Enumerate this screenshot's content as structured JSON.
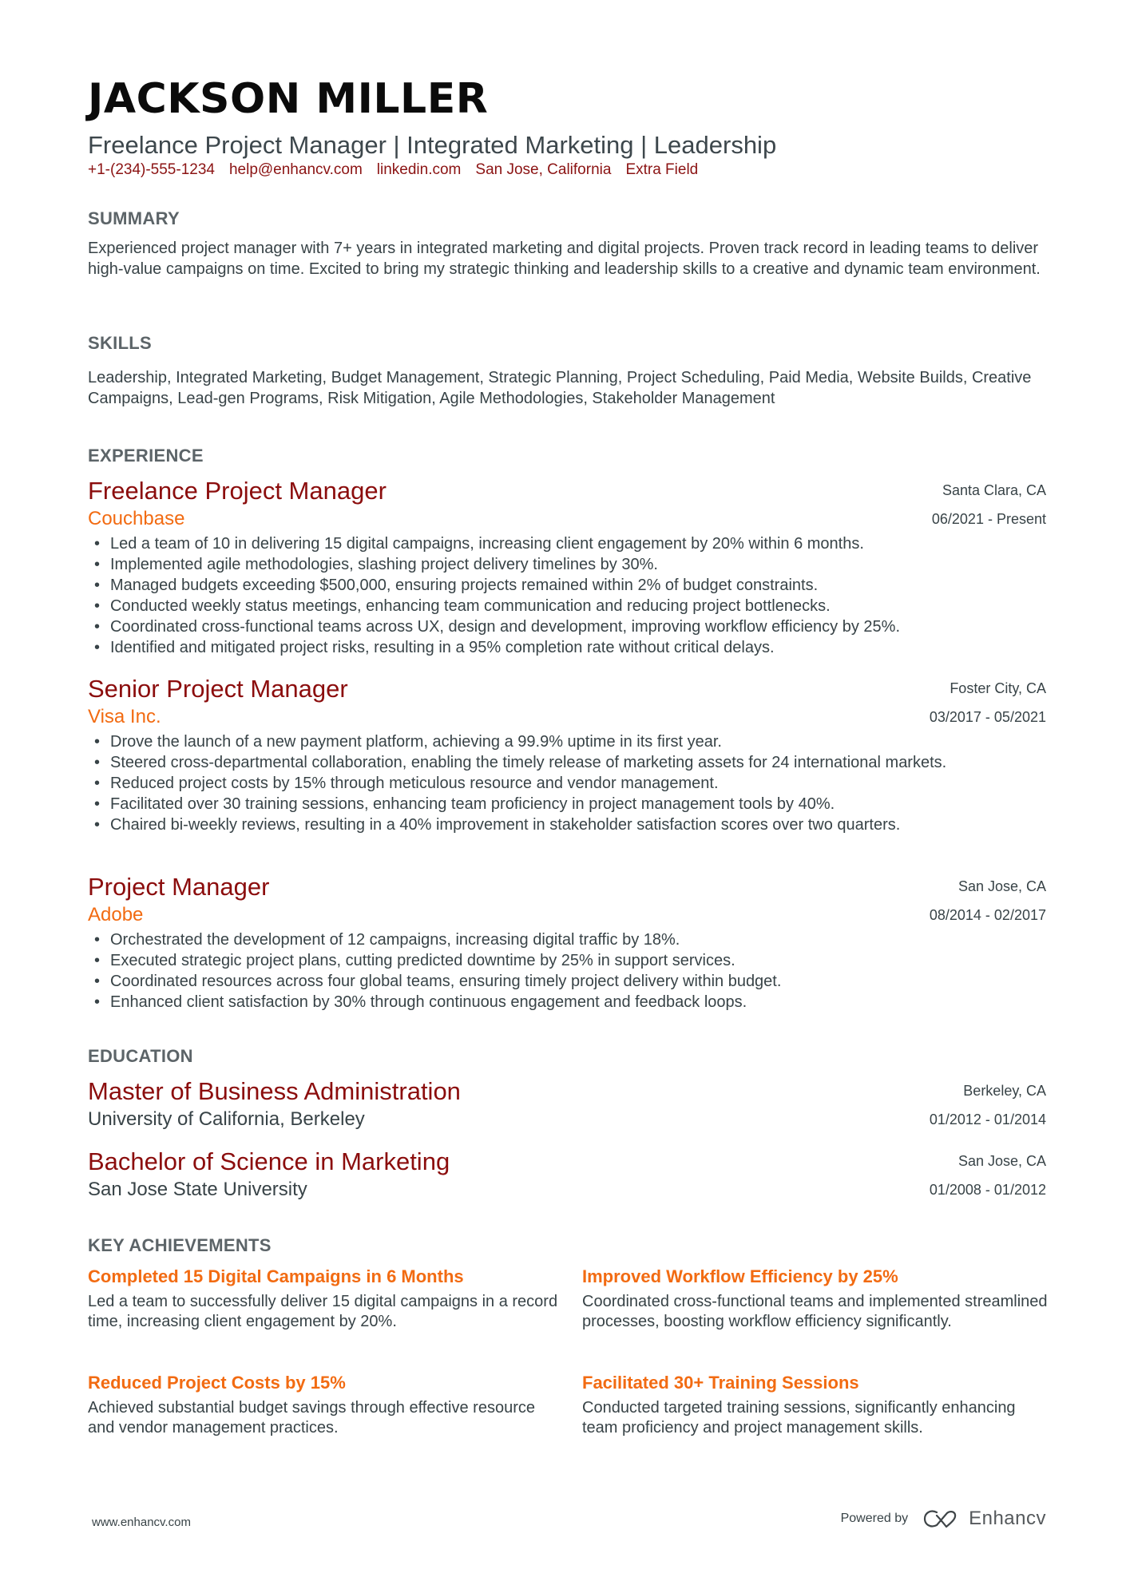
{
  "header": {
    "name": "JACKSON MILLER",
    "subtitle": "Freelance Project Manager | Integrated Marketing | Leadership",
    "contacts": [
      "+1-(234)-555-1234",
      "help@enhancv.com",
      "linkedin.com",
      "San Jose, California",
      "Extra Field"
    ]
  },
  "summary": {
    "heading": "SUMMARY",
    "text": "Experienced project manager with 7+ years in integrated marketing and digital projects. Proven track record in leading teams to deliver high-value campaigns on time. Excited to bring my strategic thinking and leadership skills to a creative and dynamic team environment."
  },
  "skills": {
    "heading": "SKILLS",
    "text": "Leadership, Integrated Marketing, Budget Management, Strategic Planning, Project Scheduling, Paid Media, Website Builds, Creative Campaigns, Lead-gen Programs, Risk Mitigation, Agile Methodologies, Stakeholder Management"
  },
  "experience": {
    "heading": "EXPERIENCE",
    "jobs": [
      {
        "title": "Freelance Project Manager",
        "company": "Couchbase",
        "location": "Santa Clara, CA",
        "dates": "06/2021 - Present",
        "bullets": [
          "Led a team of 10 in delivering 15 digital campaigns, increasing client engagement by 20% within 6 months.",
          "Implemented agile methodologies, slashing project delivery timelines by 30%.",
          "Managed budgets exceeding $500,000, ensuring projects remained within 2% of budget constraints.",
          "Conducted weekly status meetings, enhancing team communication and reducing project bottlenecks.",
          "Coordinated cross-functional teams across UX, design and development, improving workflow efficiency by 25%.",
          "Identified and mitigated project risks, resulting in a 95% completion rate without critical delays."
        ]
      },
      {
        "title": "Senior Project Manager",
        "company": "Visa Inc.",
        "location": "Foster City, CA",
        "dates": "03/2017 - 05/2021",
        "bullets": [
          "Drove the launch of a new payment platform, achieving a 99.9% uptime in its first year.",
          "Steered cross-departmental collaboration, enabling the timely release of marketing assets for 24 international markets.",
          "Reduced project costs by 15% through meticulous resource and vendor management.",
          "Facilitated over 30 training sessions, enhancing team proficiency in project management tools by 40%.",
          "Chaired bi-weekly reviews, resulting in a 40% improvement in stakeholder satisfaction scores over two quarters."
        ]
      },
      {
        "title": "Project Manager",
        "company": "Adobe",
        "location": "San Jose, CA",
        "dates": "08/2014 - 02/2017",
        "bullets": [
          "Orchestrated the development of 12 campaigns, increasing digital traffic by 18%.",
          "Executed strategic project plans, cutting predicted downtime by 25% in support services.",
          "Coordinated resources across four global teams, ensuring timely project delivery within budget.",
          "Enhanced client satisfaction by 30% through continuous engagement and feedback loops."
        ]
      }
    ]
  },
  "education": {
    "heading": "EDUCATION",
    "items": [
      {
        "degree": "Master of Business Administration",
        "school": "University of California, Berkeley",
        "location": "Berkeley, CA",
        "dates": "01/2012 - 01/2014"
      },
      {
        "degree": "Bachelor of Science in Marketing",
        "school": "San Jose State University",
        "location": "San Jose, CA",
        "dates": "01/2008 - 01/2012"
      }
    ]
  },
  "achievements": {
    "heading": "KEY ACHIEVEMENTS",
    "items": [
      {
        "title": "Completed 15 Digital Campaigns in 6 Months",
        "desc": "Led a team to successfully deliver 15 digital campaigns in a record time, increasing client engagement by 20%."
      },
      {
        "title": "Improved Workflow Efficiency by 25%",
        "desc": "Coordinated cross-functional teams and implemented streamlined processes, boosting workflow efficiency significantly."
      },
      {
        "title": "Reduced Project Costs by 15%",
        "desc": "Achieved substantial budget savings through effective resource and vendor management practices."
      },
      {
        "title": "Facilitated 30+ Training Sessions",
        "desc": "Conducted targeted training sessions, significantly enhancing team proficiency and project management skills."
      }
    ]
  },
  "footer": {
    "website": "www.enhancv.com",
    "powered_by": "Powered by",
    "brand": "Enhancv",
    "logo_icon": "enhancv-logo-icon"
  },
  "colors": {
    "title_red": "#8b0d0d",
    "accent_orange": "#f26b12",
    "contact_red": "#8b1313",
    "body_text": "#384347",
    "section_heading": "#5c6468"
  }
}
